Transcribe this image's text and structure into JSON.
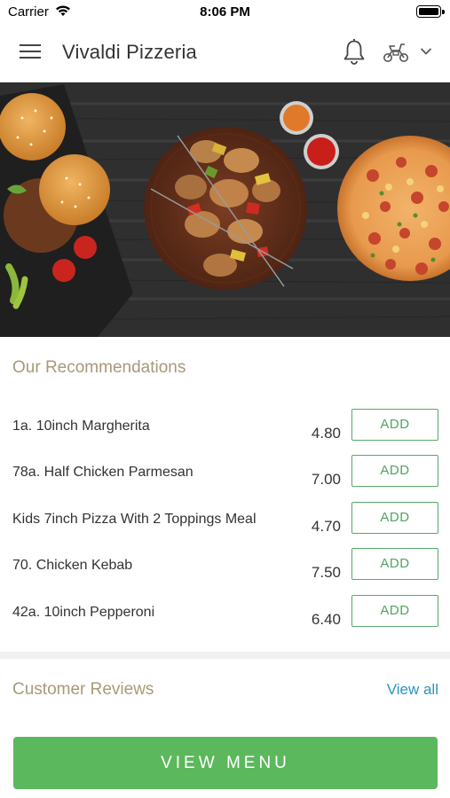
{
  "status_bar": {
    "carrier": "Carrier",
    "time": "8:06 PM"
  },
  "header": {
    "title": "Vivaldi Pizzeria"
  },
  "recommendations": {
    "title": "Our Recommendations",
    "items": [
      {
        "name": "1a. 10inch Margherita",
        "price": "4.80",
        "button": "ADD"
      },
      {
        "name": "78a. Half Chicken Parmesan",
        "price": "7.00",
        "button": "ADD"
      },
      {
        "name": "Kids 7inch Pizza With 2 Toppings Meal",
        "price": "4.70",
        "button": "ADD"
      },
      {
        "name": "70. Chicken Kebab",
        "price": "7.50",
        "button": "ADD"
      },
      {
        "name": "42a. 10inch Pepperoni",
        "price": "6.40",
        "button": "ADD"
      }
    ]
  },
  "reviews": {
    "title": "Customer Reviews",
    "view_all": "View all"
  },
  "footer": {
    "view_menu": "VIEW MENU"
  },
  "colors": {
    "accent_green": "#5cb85c",
    "section_title": "#a8997a",
    "link_blue": "#2a93c4"
  },
  "icons": [
    "hamburger-menu-icon",
    "bell-icon",
    "scooter-icon",
    "chevron-down-icon",
    "wifi-icon",
    "battery-icon"
  ]
}
